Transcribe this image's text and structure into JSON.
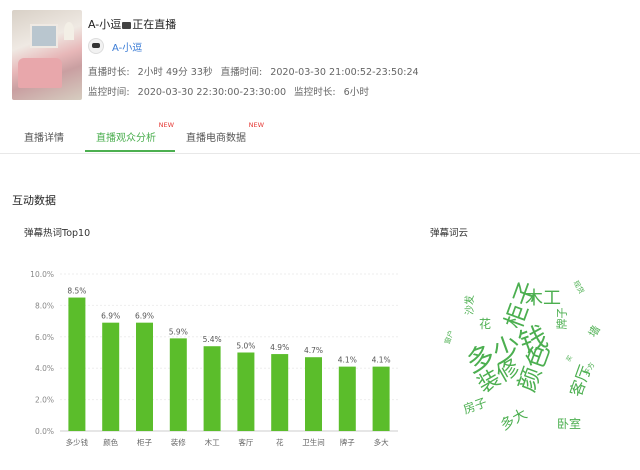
{
  "stream": {
    "title_prefix": "A-小逗",
    "title_suffix": "正在直播",
    "host_name": "A-小逗",
    "duration_label": "直播时长:",
    "duration_value": "2小时 49分 33秒",
    "time_label": "直播时间:",
    "time_value": "2020-03-30 21:00:52-23:50:24",
    "monitor_label": "监控时间:",
    "monitor_value": "2020-03-30 22:30:00-23:30:00",
    "monitor_duration_label": "监控时长:",
    "monitor_duration_value": "6小时"
  },
  "tabs": [
    {
      "label": "直播详情",
      "badge": ""
    },
    {
      "label": "直播观众分析",
      "badge": "NEW"
    },
    {
      "label": "直播电商数据",
      "badge": "NEW"
    }
  ],
  "section": {
    "title": "互动数据",
    "chart_title": "弹幕热词Top10",
    "cloud_title": "弹幕词云"
  },
  "colors": {
    "accent": "#4caf50",
    "bar": "#5bbd2b",
    "new_badge": "#e53935"
  },
  "chart_data": {
    "type": "bar",
    "categories": [
      "多少钱",
      "颜色",
      "柜子",
      "装修",
      "木工",
      "客厅",
      "花",
      "卫生间",
      "牌子",
      "多大"
    ],
    "values": [
      8.5,
      6.9,
      6.9,
      5.9,
      5.4,
      5.0,
      4.9,
      4.7,
      4.1,
      4.1
    ],
    "value_labels": [
      "8.5%",
      "6.9%",
      "6.9%",
      "5.9%",
      "5.4%",
      "5.0%",
      "4.9%",
      "4.7%",
      "4.1%",
      "4.1%"
    ],
    "ylim": [
      0,
      10
    ],
    "yticks": [
      "0.0%",
      "2.0%",
      "4.0%",
      "6.0%",
      "8.0%",
      "10.0%"
    ],
    "ytick_values": [
      0,
      2,
      4,
      6,
      8,
      10
    ],
    "grid": true
  },
  "word_cloud": [
    {
      "text": "多少钱",
      "size": "large"
    },
    {
      "text": "柜子",
      "size": "large"
    },
    {
      "text": "颜色",
      "size": "large"
    },
    {
      "text": "装修",
      "size": "large"
    },
    {
      "text": "木工",
      "size": "medium"
    },
    {
      "text": "客厅",
      "size": "medium"
    },
    {
      "text": "多大",
      "size": "medium"
    },
    {
      "text": "房子",
      "size": "small"
    },
    {
      "text": "卧室",
      "size": "small"
    },
    {
      "text": "牌子",
      "size": "small"
    },
    {
      "text": "花",
      "size": "small"
    },
    {
      "text": "沙发",
      "size": "small"
    },
    {
      "text": "墙",
      "size": "small"
    },
    {
      "text": "平方",
      "size": "tiny"
    },
    {
      "text": "现货",
      "size": "tiny"
    },
    {
      "text": "窗户",
      "size": "tiny"
    },
    {
      "text": "买",
      "size": "tiny"
    }
  ]
}
